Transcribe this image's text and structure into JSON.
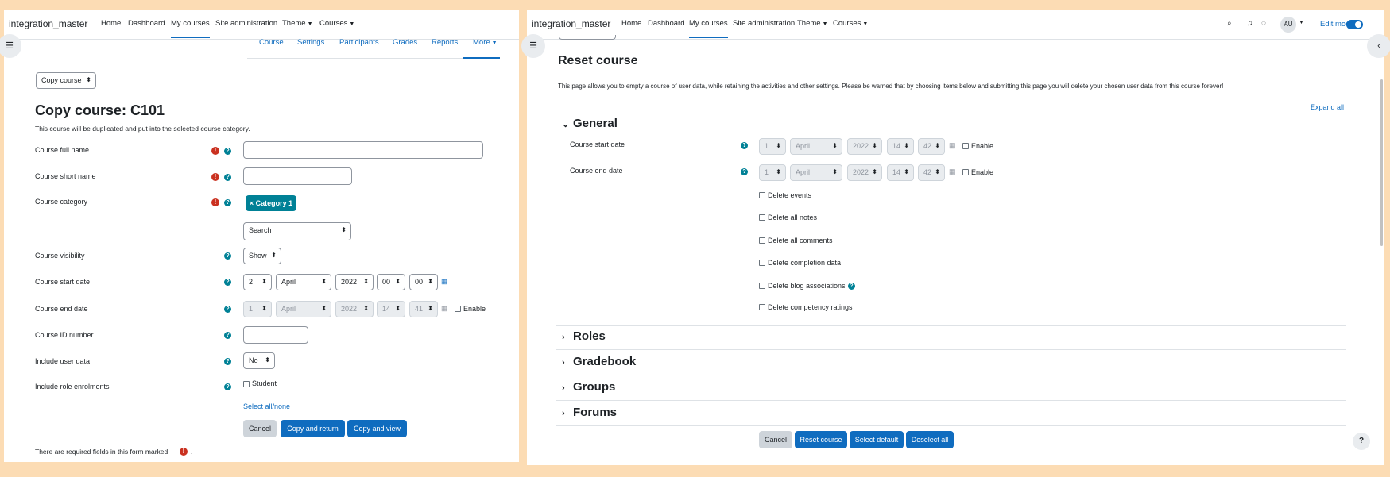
{
  "left": {
    "brand": "integration_master",
    "nav": [
      "Home",
      "Dashboard",
      "My courses",
      "Site administration",
      "Theme",
      "Courses"
    ],
    "secondary_nav": [
      "Course",
      "Settings",
      "Participants",
      "Grades",
      "Reports",
      "More"
    ],
    "copy_select": "Copy course",
    "title": "Copy course: C101",
    "description": "This course will be duplicated and put into the selected course category.",
    "labels": {
      "full_name": "Course full name",
      "short_name": "Course short name",
      "category": "Course category",
      "visibility": "Course visibility",
      "start_date": "Course start date",
      "end_date": "Course end date",
      "id_number": "Course ID number",
      "user_data": "Include user data",
      "role_enrolments": "Include role enrolments"
    },
    "category_badge": "× Category 1",
    "search_placeholder": "Search",
    "visibility_value": "Show",
    "start": {
      "day": "2",
      "month": "April",
      "year": "2022",
      "hour": "00",
      "minute": "00"
    },
    "end": {
      "day": "1",
      "month": "April",
      "year": "2022",
      "hour": "14",
      "minute": "41",
      "enable": "Enable"
    },
    "user_data_value": "No",
    "student_label": "Student",
    "select_all": "Select all/none",
    "buttons": {
      "cancel": "Cancel",
      "copy_return": "Copy and return",
      "copy_view": "Copy and view"
    },
    "required_note": "There are required fields in this form marked",
    "required_note_end": "."
  },
  "right": {
    "brand": "integration_master",
    "nav": [
      "Home",
      "Dashboard",
      "My courses",
      "Site administration",
      "Theme",
      "Courses"
    ],
    "avatar": "AU",
    "edit_mode": "Edit mode",
    "title": "Reset course",
    "description": "This page allows you to empty a course of user data, while retaining the activities and other settings. Please be warned that by choosing items below and submitting this page you will delete your chosen user data from this course forever!",
    "expand_all": "Expand all",
    "general": "General",
    "start_label": "Course start date",
    "end_label": "Course end date",
    "start": {
      "day": "1",
      "month": "April",
      "year": "2022",
      "hour": "14",
      "minute": "42",
      "enable": "Enable"
    },
    "end": {
      "day": "1",
      "month": "April",
      "year": "2022",
      "hour": "14",
      "minute": "42",
      "enable": "Enable"
    },
    "checkboxes": [
      "Delete events",
      "Delete all notes",
      "Delete all comments",
      "Delete completion data",
      "Delete blog associations",
      "Delete competency ratings"
    ],
    "sections": [
      "Roles",
      "Gradebook",
      "Groups",
      "Forums"
    ],
    "buttons": {
      "cancel": "Cancel",
      "reset": "Reset course",
      "select_default": "Select default",
      "deselect_all": "Deselect all"
    },
    "help": "?"
  }
}
